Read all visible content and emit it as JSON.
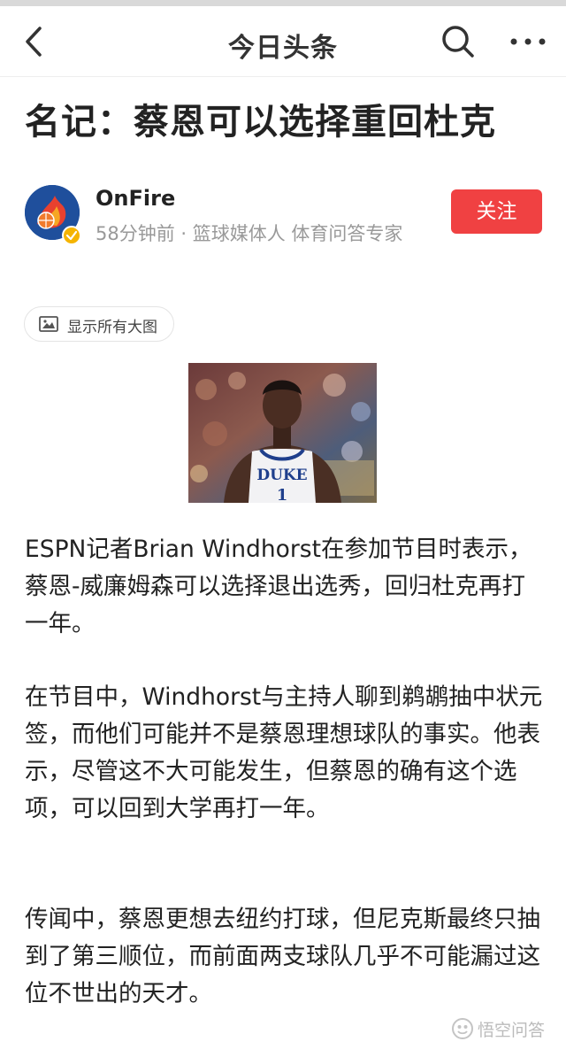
{
  "navbar": {
    "title": "今日头条",
    "back_icon": "chevron-left-icon",
    "search_icon": "search-icon",
    "more_icon": "more-icon"
  },
  "article": {
    "title": "名记：蔡恩可以选择重回杜克",
    "author": {
      "name": "OnFire",
      "meta": "58分钟前 · 篮球媒体人 体育问答专家",
      "follow_label": "关注",
      "follow_color": "#f04142"
    },
    "show_images_label": "显示所有大图",
    "photo_jersey_text": "DUKE",
    "photo_jersey_number": "1",
    "paragraphs": [
      "ESPN记者Brian Windhorst在参加节目时表示，蔡恩-威廉姆森可以选择退出选秀，回归杜克再打一年。",
      "在节目中，Windhorst与主持人聊到鹈鹕抽中状元签，而他们可能并不是蔡恩理想球队的事实。他表示，尽管这不大可能发生，但蔡恩的确有这个选项，可以回到大学再打一年。",
      "传闻中，蔡恩更想去纽约打球，但尼克斯最终只抽到了第三顺位，而前面两支球队几乎不可能漏过这位不世出的天才。"
    ]
  },
  "watermark": {
    "text": "悟空问答"
  }
}
